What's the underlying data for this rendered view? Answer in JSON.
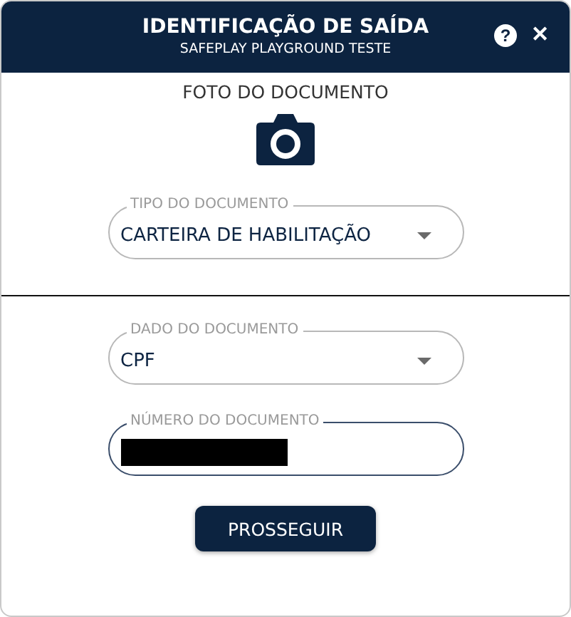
{
  "window": {
    "title": "IDENTIFICAÇÃO DE SAÍDA",
    "subtitle": "SAFEPLAY PLAYGROUND TESTE",
    "help_button": "?",
    "close_button": "✕"
  },
  "photo": {
    "label": "FOTO DO DOCUMENTO"
  },
  "document_type": {
    "kind": "select",
    "label": "TIPO DO DOCUMENTO",
    "value": "CARTEIRA DE HABILITAÇÃO",
    "focused": false
  },
  "fields": [
    {
      "kind": "select",
      "label": "DADO DO DOCUMENTO",
      "value": "CPF",
      "focused": false
    },
    {
      "kind": "redacted",
      "label": "NÚMERO DO DOCUMENTO",
      "focused": true
    }
  ],
  "submit_button": "PROSSEGUIR"
}
